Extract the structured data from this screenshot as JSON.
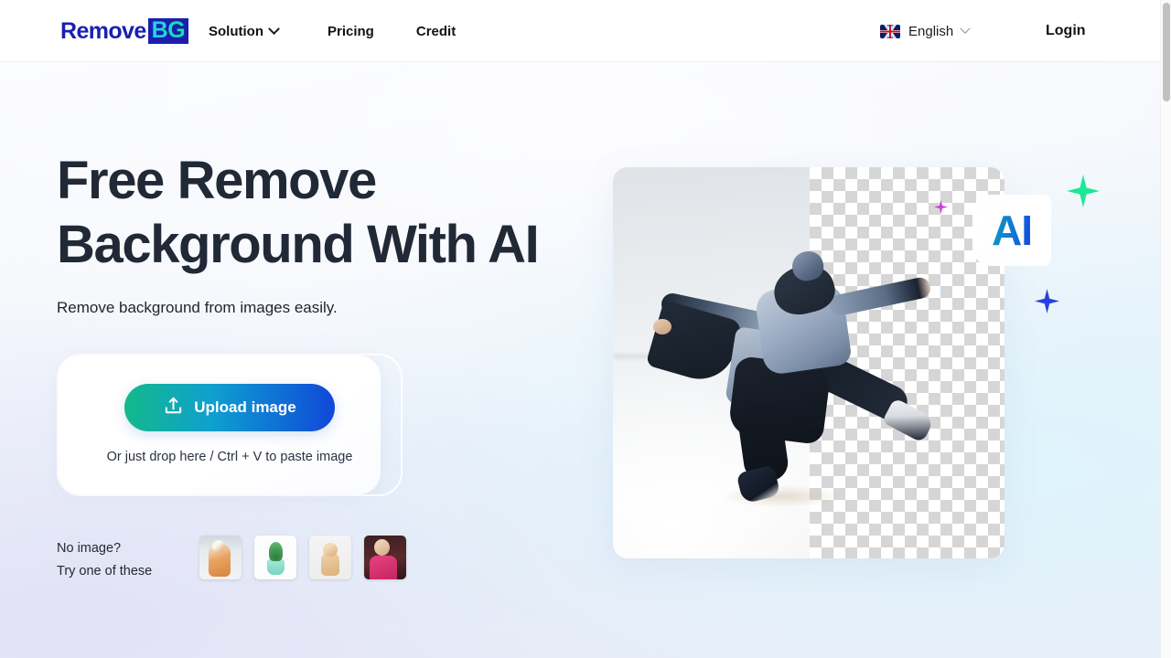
{
  "header": {
    "logo": {
      "primary": "Remove",
      "badge": "BG"
    },
    "nav": [
      {
        "label": "Solution",
        "icon": "chevron-down-icon",
        "has_dropdown": true
      },
      {
        "label": "Pricing",
        "has_dropdown": false
      },
      {
        "label": "Credit",
        "has_dropdown": false
      }
    ],
    "language": {
      "label": "English",
      "flag_icon": "uk-flag-icon",
      "caret_icon": "chevron-down-icon"
    },
    "login_label": "Login"
  },
  "hero": {
    "title_line1": "Free Remove",
    "title_line2": "Background With AI",
    "subtitle": "Remove background from images easily.",
    "upload": {
      "button_label": "Upload image",
      "button_icon": "upload-icon",
      "drop_hint": "Or just drop here / Ctrl + V to paste image"
    },
    "samples": {
      "label_line1": "No image?",
      "label_line2": "Try one of these",
      "thumbnails": [
        {
          "name": "cat-thumbnail"
        },
        {
          "name": "plant-thumbnail"
        },
        {
          "name": "dog-thumbnail"
        },
        {
          "name": "person-thumbnail"
        }
      ]
    },
    "preview": {
      "badge_text": "AI",
      "subject": "jumping-person-photo",
      "sparkles": [
        "green-sparkle",
        "blue-sparkle",
        "pink-sparkle"
      ]
    }
  },
  "colors": {
    "logo_blue": "#1a1fb0",
    "logo_badge_gradient_start": "#22d3f0",
    "logo_badge_gradient_end": "#18e39a",
    "upload_gradient_start": "#13b98b",
    "upload_gradient_end": "#1048d8",
    "heading": "#212936",
    "ai_gradient_start": "#0e9bc4",
    "ai_gradient_end": "#1540e0",
    "sparkle_green": "#1ee896",
    "sparkle_blue": "#2741e0",
    "sparkle_pink": "#cc3fd4"
  }
}
